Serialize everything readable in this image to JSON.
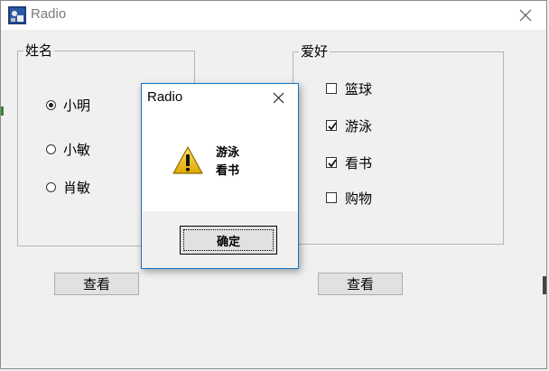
{
  "window": {
    "title": "Radio"
  },
  "name_group": {
    "legend": "姓名",
    "options": [
      {
        "label": "小明",
        "checked": true
      },
      {
        "label": "小敏",
        "checked": false
      },
      {
        "label": "肖敏",
        "checked": false
      }
    ],
    "view_button": "查看"
  },
  "hobby_group": {
    "legend": "爱好",
    "options": [
      {
        "label": "篮球",
        "checked": false
      },
      {
        "label": "游泳",
        "checked": true
      },
      {
        "label": "看书",
        "checked": true
      },
      {
        "label": "购物",
        "checked": false
      }
    ],
    "view_button": "查看"
  },
  "dialog": {
    "title": "Radio",
    "icon": "warning-icon",
    "message_lines": [
      "游泳",
      "看书"
    ],
    "ok_button": "确定"
  },
  "colors": {
    "dialog_border": "#1a73c2",
    "warning_yellow": "#f5c518"
  }
}
